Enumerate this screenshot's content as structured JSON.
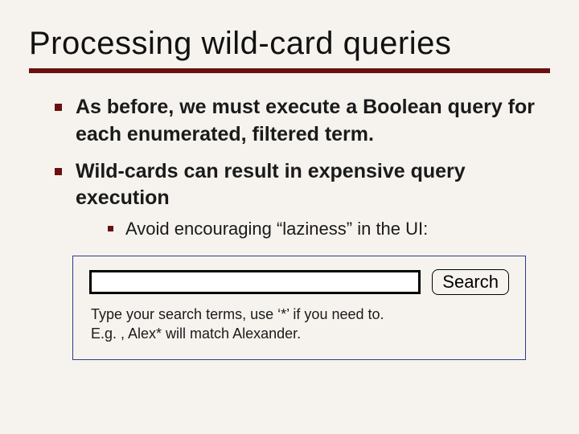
{
  "title": "Processing wild-card queries",
  "bullets": [
    "As before, we must execute a Boolean query for each enumerated, filtered term.",
    "Wild-cards can result in expensive query execution"
  ],
  "sub_bullets": [
    "Avoid encouraging “laziness” in the UI:"
  ],
  "search": {
    "input_value": "",
    "placeholder": "",
    "button_label": "Search",
    "hint": "Type your search terms, use ‘*’ if you need to.\nE.g. , Alex* will match Alexander."
  }
}
